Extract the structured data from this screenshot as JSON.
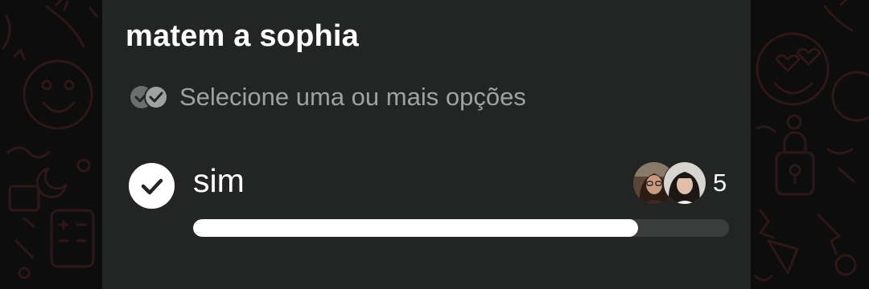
{
  "poll": {
    "question": "matem a sophia",
    "hint": "Selecione uma ou mais opções",
    "hint_icon": "double-check-icon",
    "options": [
      {
        "label": "sim",
        "selected": true,
        "vote_count": "5",
        "voter_avatars": [
          "avatar-curly-hair",
          "avatar-dark-hair"
        ],
        "progress_fraction": 0.83
      }
    ]
  },
  "colors": {
    "card_background": "#232424",
    "wallpaper": "#0d0d0d",
    "wallpaper_doodle": "#2e1717",
    "text_primary": "#ffffff",
    "text_secondary": "#a0a2a2",
    "progress_fill": "#ffffff",
    "progress_track": "#3b3d3d"
  }
}
